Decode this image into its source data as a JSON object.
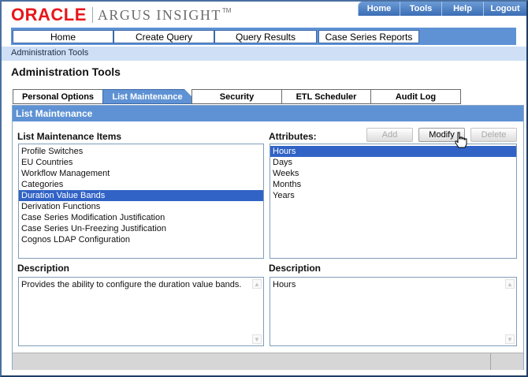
{
  "brand": {
    "oracle": "ORACLE",
    "product": "ARGUS INSIGHT",
    "tm": "TM"
  },
  "util_nav": [
    "Home",
    "Tools",
    "Help",
    "Logout"
  ],
  "global_nav": [
    "Home",
    "Create Query",
    "Query Results",
    "Case Series Reports"
  ],
  "breadcrumb": "Administration Tools",
  "page_title": "Administration Tools",
  "section_tabs": [
    "Personal Options",
    "List Maintenance",
    "Security",
    "ETL Scheduler",
    "Audit Log"
  ],
  "active_tab": "List Maintenance",
  "panel_title": "List Maintenance",
  "items_label": "List Maintenance Items",
  "items": [
    "Profile Switches",
    "EU Countries",
    "Workflow Management",
    "Categories",
    "Duration Value Bands",
    "Derivation Functions",
    "Case Series Modification Justification",
    "Case Series Un-Freezing Justification",
    "Cognos LDAP Configuration"
  ],
  "selected_item": "Duration Value Bands",
  "attributes_label": "Attributes:",
  "buttons": {
    "add": "Add",
    "modify": "Modify",
    "delete": "Delete"
  },
  "attributes": [
    "Hours",
    "Days",
    "Weeks",
    "Months",
    "Years"
  ],
  "selected_attribute": "Hours",
  "left_description_label": "Description",
  "left_description": "Provides the ability to configure the duration value bands.",
  "right_description_label": "Description",
  "right_description": "Hours",
  "colors": {
    "nav_blue": "#5e92d4",
    "selection_blue": "#3163c6",
    "brand_red": "#e8161b",
    "crumb_bg": "#cfe0f6"
  },
  "icons": {
    "scroll_up": "triangle-up-icon",
    "scroll_down": "triangle-down-icon",
    "pointer": "hand-cursor-icon"
  }
}
